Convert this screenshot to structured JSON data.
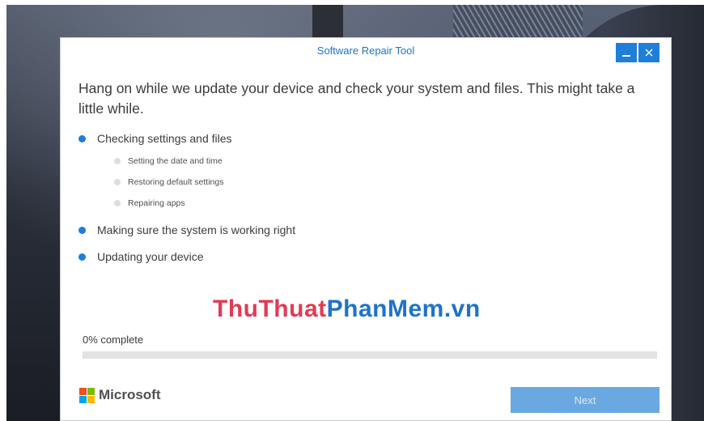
{
  "window": {
    "title": "Software Repair Tool",
    "minimize_icon": "minimize-icon",
    "close_icon": "close-icon",
    "accent_color": "#1e7fd8"
  },
  "headline": "Hang on while we update your device and check your system and files. This might take a little while.",
  "steps": [
    {
      "label": "Checking settings and files",
      "substeps": [
        {
          "label": "Setting the date and time"
        },
        {
          "label": "Restoring default settings"
        },
        {
          "label": "Repairing apps"
        }
      ]
    },
    {
      "label": "Making sure the system is working right"
    },
    {
      "label": "Updating your device"
    }
  ],
  "watermark": {
    "part1": "ThuThuat",
    "part2": "PhanMem.vn"
  },
  "progress": {
    "label": "0% complete",
    "value_percent": 0
  },
  "footer": {
    "brand": "Microsoft",
    "logo_colors": [
      "#f25022",
      "#7fba00",
      "#00a4ef",
      "#ffb900"
    ],
    "next_label": "Next"
  }
}
